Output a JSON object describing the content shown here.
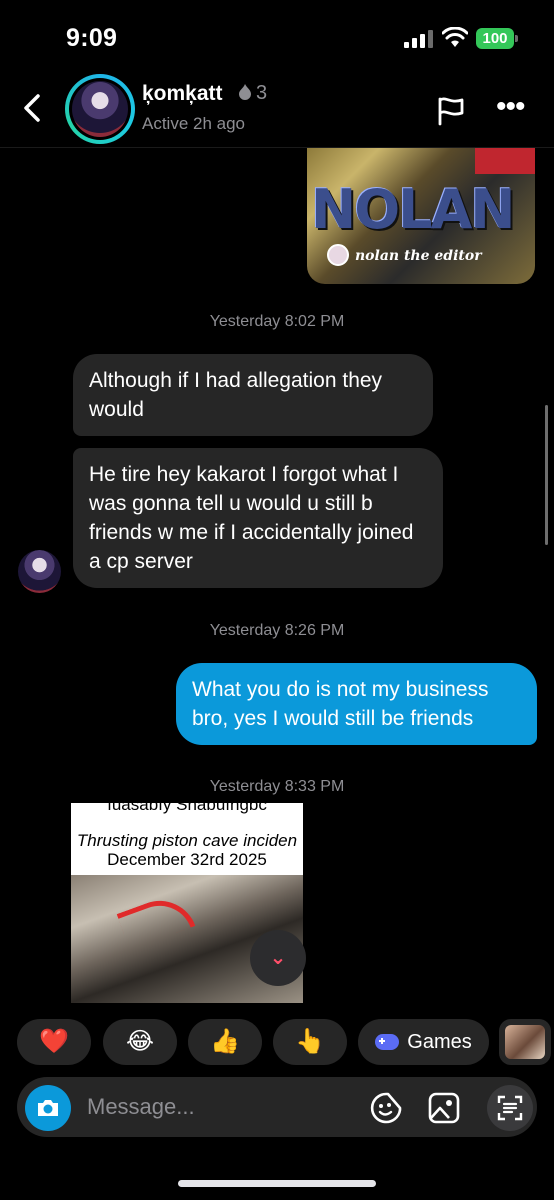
{
  "status_bar": {
    "time": "9:09",
    "battery": "100"
  },
  "header": {
    "name": "ķomķatt",
    "streak_count": "3",
    "active_status": "Active 2h ago",
    "back_icon": "chevron-left-icon",
    "flag_icon": "flag-icon",
    "more_icon": "ellipsis-icon"
  },
  "messages": {
    "image1_caption": "nolan the editor",
    "image1_title": "NOLAN",
    "ts1": "Yesterday 8:02 PM",
    "in1": "Although if I had allegation they would",
    "in2": "He tire hey kakarot I forgot what I was gonna tell u would u still b friends w me if I accidentally joined a cp server",
    "ts2": "Yesterday 8:26 PM",
    "out1": "What you do is not my business bro, yes I would still be friends",
    "ts3": "Yesterday 8:33 PM",
    "image2_line1": "ıuasabıy Snabuıngbc",
    "image2_line2": "Thrusting piston cave inciden",
    "image2_line3": "December 32rd 2025"
  },
  "reactions": {
    "heart": "❤️",
    "laugh": "😂",
    "thumbs": "👍",
    "point": "👆",
    "games": "Games"
  },
  "composer": {
    "placeholder": "Message..."
  },
  "colors": {
    "accent": "#0b99da",
    "bubble_in": "#262626",
    "background": "#000000",
    "battery": "#34c759"
  }
}
